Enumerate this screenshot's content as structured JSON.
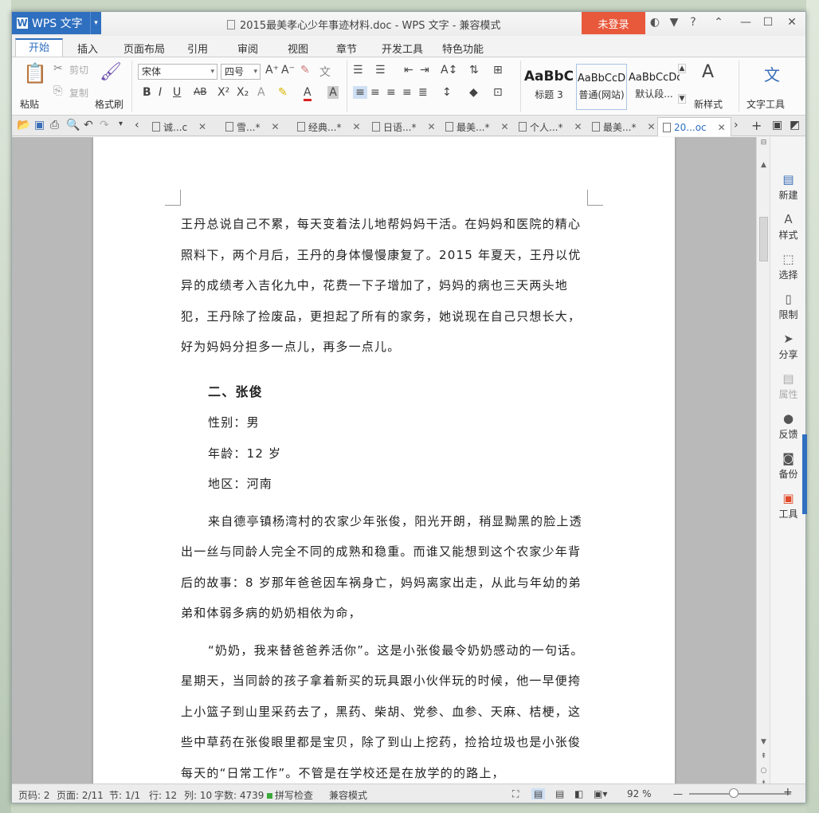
{
  "app": {
    "name": "WPS 文字",
    "logo": "W"
  },
  "title": "2015最美孝心少年事迹材料.doc - WPS 文字 - 兼容模式",
  "login_label": "未登录",
  "menu_tabs": [
    "开始",
    "插入",
    "页面布局",
    "引用",
    "审阅",
    "视图",
    "章节",
    "开发工具",
    "特色功能"
  ],
  "ribbon": {
    "paste": "粘贴",
    "cut": "剪切",
    "copy": "复制",
    "format_painter": "格式刷",
    "font": "宋体",
    "font_size": "四号",
    "styles": [
      {
        "preview": "AaBbC",
        "label": "标题 3"
      },
      {
        "preview": "AaBbCcD",
        "label": "普通(网站)"
      },
      {
        "preview": "AaBbCcDc",
        "label": "默认段..."
      }
    ],
    "new_style": "新样式",
    "text_tools": "文字工具"
  },
  "doc_tabs": [
    "诚...c",
    "雪...*",
    "经典...*",
    "日语...*",
    "最美...*",
    "个人...*",
    "最美...*",
    "20...oc"
  ],
  "document": {
    "para1": "王丹总说自己不累，每天变着法儿地帮妈妈干活。在妈妈和医院的精心照料下，两个月后，王丹的身体慢慢康复了。2015 年夏天，王丹以优异的成绩考入吉化九中，花费一下子增加了，妈妈的病也三天两头地犯，王丹除了捡废品，更担起了所有的家务，她说现在自己只想长大，好为妈妈分担多一点儿，再多一点儿。",
    "heading": "二、张俊",
    "gender": "性别：男",
    "age": "年龄：12 岁",
    "region": "地区：河南",
    "para2": "来自德亭镇杨湾村的农家少年张俊，阳光开朗，稍显黝黑的脸上透出一丝与同龄人完全不同的成熟和稳重。而谁又能想到这个农家少年背后的故事：8 岁那年爸爸因车祸身亡，妈妈离家出走，从此与年幼的弟弟和体弱多病的奶奶相依为命，",
    "para3": "“奶奶，我来替爸爸养活你”。这是小张俊最令奶奶感动的一句话。星期天，当同龄的孩子拿着新买的玩具跟小伙伴玩的时候，他一早便挎上小篮子到山里采药去了，黑药、柴胡、党参、血参、天麻、桔梗，这些中草药在张俊眼里都是宝贝，除了到山上挖药，捡拾垃圾也是小张俊每天的“日常工作”。不管是在学校还是在放学的的路上，"
  },
  "right_panel": [
    "新建",
    "样式",
    "选择",
    "限制",
    "分享",
    "属性",
    "反馈",
    "备份",
    "工具"
  ],
  "status": {
    "page_code": "页码: 2",
    "page": "页面: 2/11",
    "section": "节: 1/1",
    "row": "行: 12",
    "col": "列: 10",
    "words": "字数: 4739",
    "spell": "拼写检查",
    "compat": "兼容模式",
    "zoom": "92 %",
    "zoom_value": 0.92
  }
}
